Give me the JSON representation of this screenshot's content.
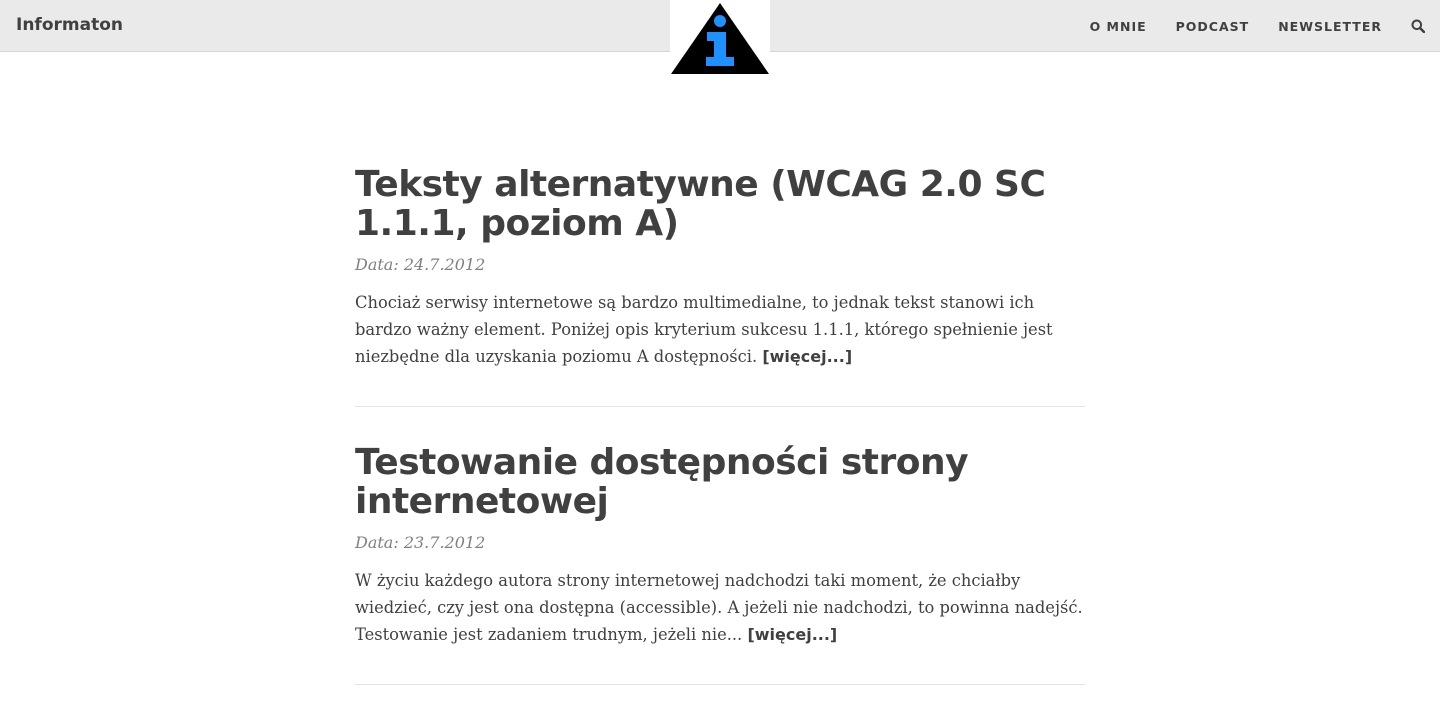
{
  "header": {
    "brand": "Informaton",
    "logo_icon": "information-triangle-icon",
    "logo_colors": {
      "triangle": "#000000",
      "letter": "#1e90ff"
    },
    "nav": [
      {
        "label": "O MNIE"
      },
      {
        "label": "PODCAST"
      },
      {
        "label": "NEWSLETTER"
      }
    ],
    "search_icon": "search-icon"
  },
  "posts": [
    {
      "title": "Teksty alternatywne (WCAG 2.0 SC 1.1.1, poziom A)",
      "date": "Data: 24.7.2012",
      "excerpt": "Chociaż serwisy internetowe są bardzo multimedialne, to jednak tekst stanowi ich bardzo ważny element. Poniżej opis kryterium sukcesu 1.1.1, którego spełnienie jest niezbędne dla uzyskania poziomu A dostępności.",
      "more": "[więcej...]"
    },
    {
      "title": "Testowanie dostępności strony internetowej",
      "date": "Data: 23.7.2012",
      "excerpt": "W życiu każdego autora strony internetowej nadchodzi taki moment, że chciałby wiedzieć, czy jest ona dostępna (accessible). A jeżeli nie nadchodzi, to powinna nadejść. Testowanie jest zadaniem trudnym, jeżeli nie...",
      "more": "[więcej...]"
    }
  ]
}
